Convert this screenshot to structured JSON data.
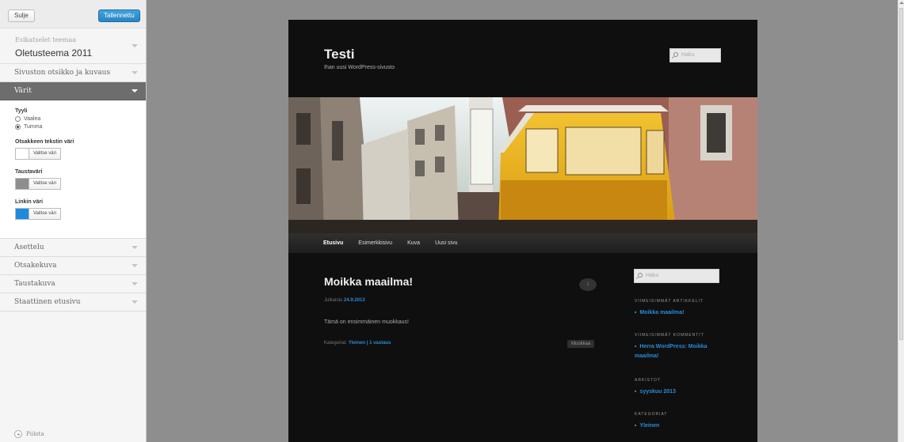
{
  "customizer": {
    "close_label": "Sulje",
    "save_label": "Tallennettu",
    "theme_sub": "Esikatselet teemaa",
    "theme_name": "Oletusteema 2011",
    "sections_top": [
      "Sivuston otsikko ja kuvaus"
    ],
    "active_section": "Värit",
    "style_title": "Tyyli",
    "style_options": [
      "Vaalea",
      "Tumma"
    ],
    "style_selected": "Tumma",
    "color_controls": [
      {
        "label": "Otsakkeen tekstin väri",
        "color": "#ffffff",
        "button": "Valitse väri"
      },
      {
        "label": "Taustaväri",
        "color": "#8e8e8e",
        "button": "Valitse väri"
      },
      {
        "label": "Linkin väri",
        "color": "#1b8be0",
        "button": "Valitse väri"
      }
    ],
    "sections_bottom": [
      "Asettelu",
      "Otsakekuva",
      "Taustakuva",
      "Staattinen etusivu"
    ],
    "hide_label": "Piilota",
    "hide_icon": "collapse-arrow-icon"
  },
  "site": {
    "title": "Testi",
    "tagline": "Ihan uusi WordPress-sivusto",
    "search_placeholder": "Haku",
    "nav": [
      "Etusivu",
      "Esimerkkisivu",
      "Kuva",
      "Uusi sivu"
    ],
    "post": {
      "title": "Moikka maailma!",
      "comment_count": "1",
      "meta_prefix": "Julkaistu",
      "date": "24.9.2013",
      "content": "Tämä on ensimmäinen muokkaus!",
      "categories_prefix": "Kategoriat:",
      "category": "Yleinen",
      "separator": "|",
      "replies": "1 vastaus",
      "edit": "Muokkaa"
    },
    "widgets": {
      "recent_posts_title": "VIIMEISIMMÄT ARTIKKELIT",
      "recent_posts": [
        "Moikka maailma!"
      ],
      "recent_comments_title": "VIIMEISIMMÄT KOMMENTIT",
      "recent_comments": [
        "Herra WordPress: Moikka maailma!"
      ],
      "archives_title": "ARKISTOT",
      "archives": [
        "syyskuu 2013"
      ],
      "categories_title": "KATEGORIAT",
      "categories": [
        "Yleinen"
      ]
    }
  },
  "colors": {
    "accent": "#2a8bd5",
    "site_bg": "#0f0f0f",
    "preview_bg": "#8e8e8e"
  }
}
